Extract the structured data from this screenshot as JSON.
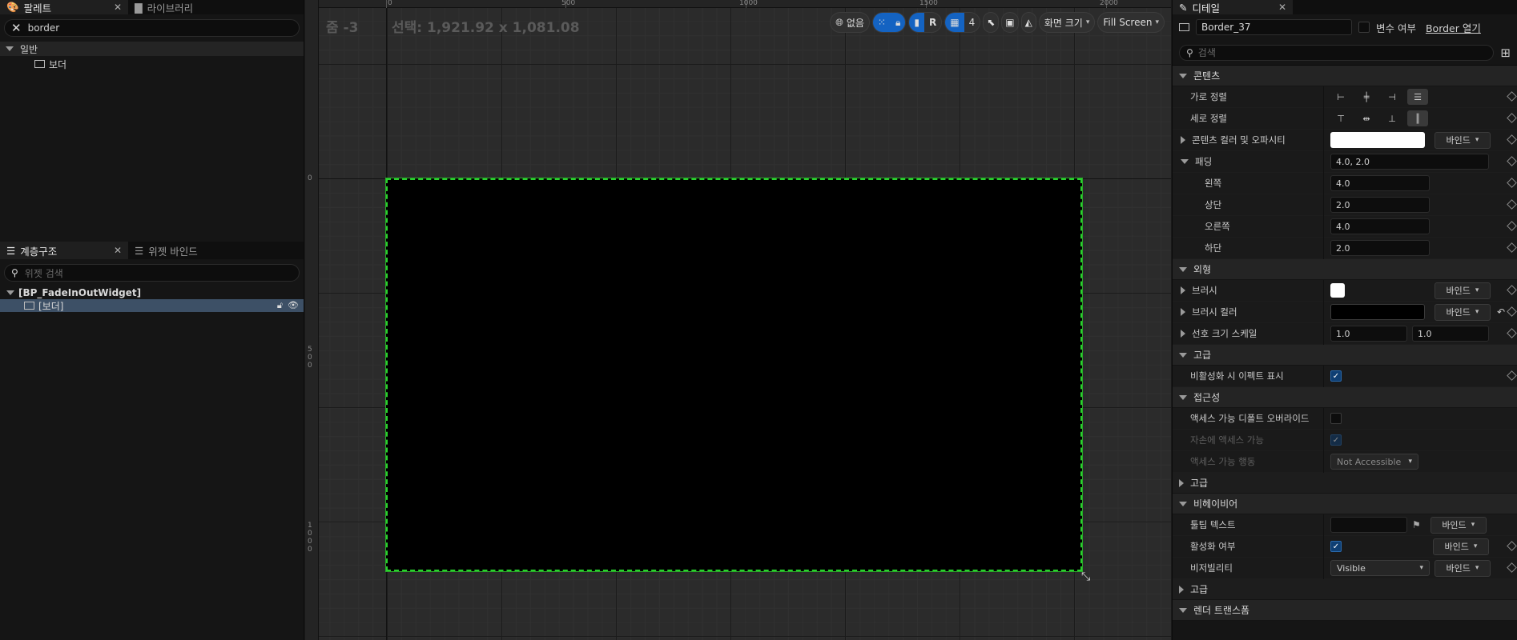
{
  "left": {
    "palette_tab": "팔레트",
    "library_tab": "라이브러리",
    "palette_search_value": "border",
    "category": "일반",
    "palette_item": "보더",
    "hierarchy_tab": "계층구조",
    "binding_tab": "위젯 바인드",
    "hierarchy_search_placeholder": "위젯 검색",
    "root_widget": "[BP_FadeInOutWidget]",
    "child_widget": "[보더]"
  },
  "viewport": {
    "zoom_label": "줌 -3",
    "selection_label": "선택: 1,921.92 x 1,081.08",
    "ruler_x": [
      "0",
      "500",
      "1000",
      "1500",
      "2000"
    ],
    "ruler_y": [
      "0",
      "500",
      "1000"
    ],
    "toolbar": {
      "none_label": "없음",
      "r_label": "R",
      "grid_count": "4",
      "screen_size_label": "화면 크기",
      "fill_screen_label": "Fill Screen"
    }
  },
  "details": {
    "tab_title": "디테일",
    "widget_name": "Border_37",
    "is_variable_label": "변수 여부",
    "open_border_label": "Border 열기",
    "search_placeholder": "검색",
    "sections": {
      "content": "콘텐츠",
      "appearance": "외형",
      "advanced1": "고급",
      "accessibility": "접근성",
      "advanced2": "고급",
      "behavior": "비헤이비어",
      "advanced3": "고급",
      "render_transform": "렌더 트랜스폼"
    },
    "props": {
      "h_align": "가로 정렬",
      "v_align": "세로 정렬",
      "content_color": "콘텐츠 컬러 및 오파시티",
      "padding": "패딩",
      "padding_value": "4.0, 2.0",
      "left": "왼쪽",
      "left_value": "4.0",
      "top": "상단",
      "top_value": "2.0",
      "right": "오른쪽",
      "right_value": "4.0",
      "bottom": "하단",
      "bottom_value": "2.0",
      "brush": "브러시",
      "brush_color": "브러시 컬러",
      "desired_size_scale": "선호 크기 스케일",
      "scale_x": "1.0",
      "scale_y": "1.0",
      "show_effect_disabled": "비활성화 시 이펙트 표시",
      "override_access": "액세스 가능 디폴트 오버라이드",
      "children_access": "자손에 액세스 가능",
      "access_behavior": "액세스 가능 행동",
      "access_behavior_value": "Not Accessible",
      "tooltip_text": "툴팁 텍스트",
      "is_enabled": "활성화 여부",
      "visibility": "비저빌리티",
      "visibility_value": "Visible"
    },
    "bind_label": "바인드"
  },
  "colors": {
    "selection_outline": "#29d32d",
    "accent_blue": "#1463c2"
  }
}
